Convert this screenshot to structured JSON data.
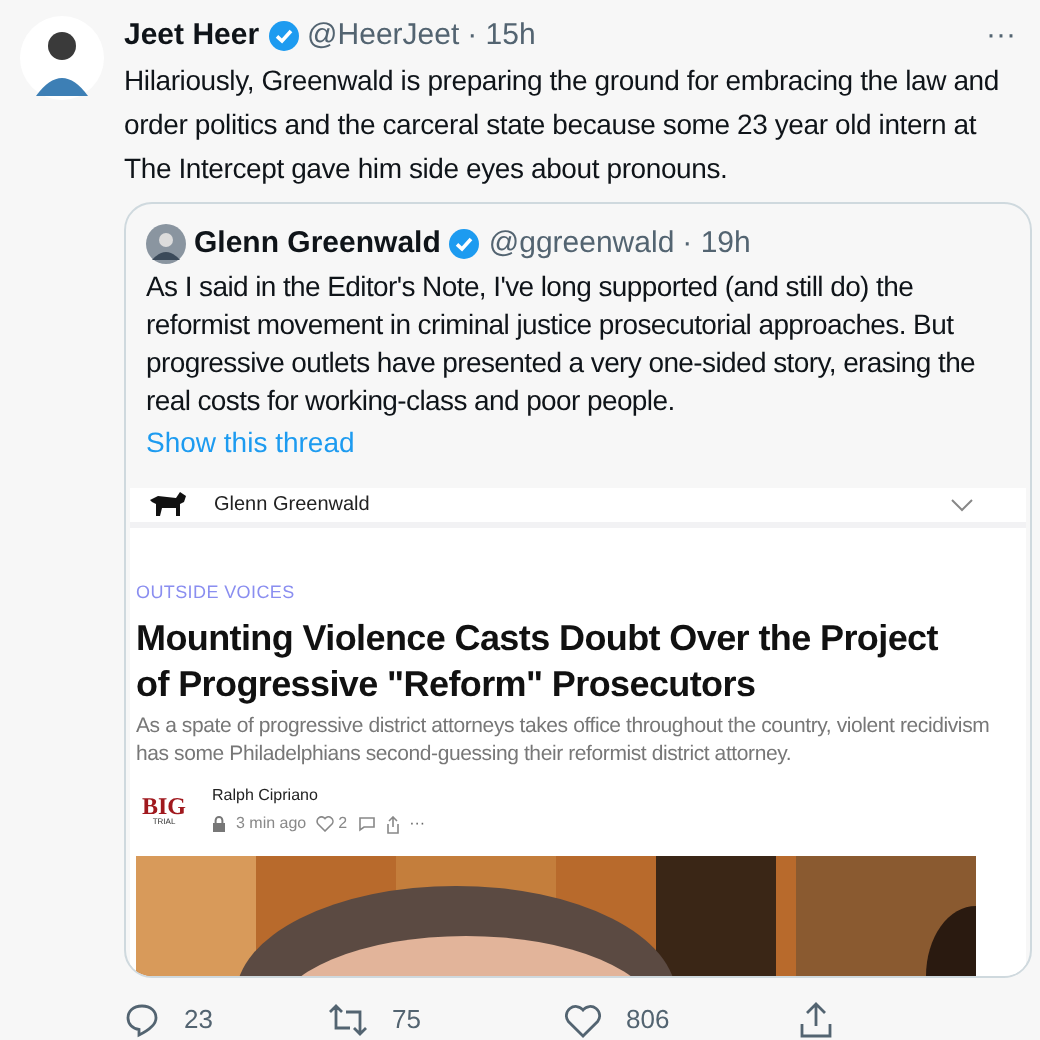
{
  "tweet": {
    "author": "Jeet Heer",
    "handle": "@HeerJeet",
    "time": "· 15h",
    "verified": true,
    "text": "Hilariously, Greenwald is preparing the ground for embracing the law and order politics and the carceral state because some 23 year old intern at The Intercept gave him side eyes about pronouns.",
    "more": "···"
  },
  "quoted": {
    "author": "Glenn Greenwald",
    "handle": "@ggreenwald",
    "time": "· 19h",
    "verified": true,
    "text": "As I said in the Editor's Note, I've long supported (and still do) the reformist movement in criminal justice prosecutorial approaches. But progressive outlets have presented a very one-sided story, erasing the real costs for working-class and poor people.",
    "show_thread": "Show this thread"
  },
  "embed": {
    "publication": "Glenn Greenwald",
    "section": "OUTSIDE VOICES",
    "headline": "Mounting Violence Casts Doubt Over the Project of Progressive \"Reform\" Prosecutors",
    "subtitle": "As a spate of progressive district attorneys takes office throughout the country, violent recidivism has some Philadelphians second-guessing their reformist district attorney.",
    "logo": [
      "BIG",
      "TRIAL"
    ],
    "author": "Ralph Cipriano",
    "ago": "3 min ago",
    "likes": "2",
    "more": "···"
  },
  "actions": [
    {
      "kind": "reply",
      "count": "23"
    },
    {
      "kind": "retweet",
      "count": "75"
    },
    {
      "kind": "like",
      "count": "806"
    },
    {
      "kind": "share"
    }
  ]
}
